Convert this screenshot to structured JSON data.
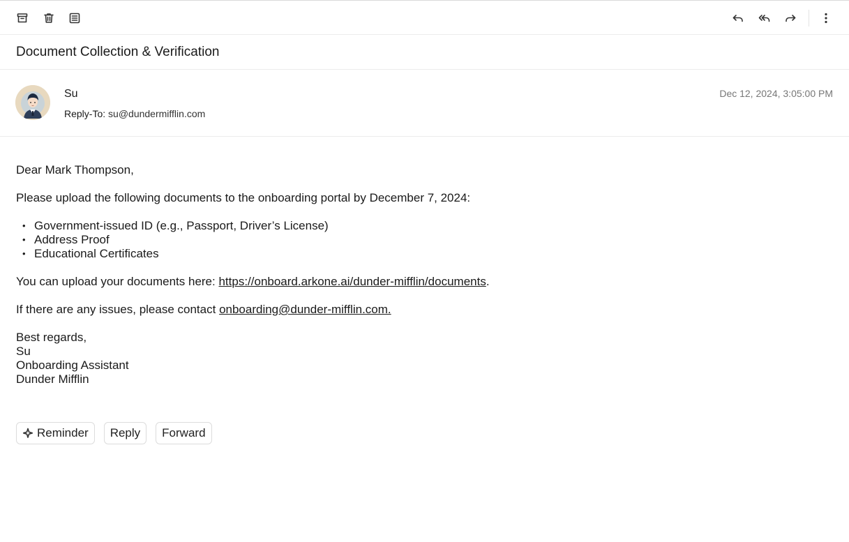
{
  "toolbar": {
    "left_icons": [
      "archive-icon",
      "trash-icon",
      "notes-icon"
    ],
    "right_icons": [
      "reply-icon",
      "reply-all-icon",
      "forward-icon",
      "more-vertical-icon"
    ]
  },
  "email": {
    "subject": "Document Collection & Verification",
    "sender_name": "Su",
    "reply_to_label": "Reply-To:",
    "reply_to_address": "su@dundermifflin.com",
    "date": "Dec 12, 2024, 3:05:00 PM",
    "greeting": "Dear Mark Thompson,",
    "intro": "Please upload the following documents to the onboarding portal by December 7, 2024:",
    "documents": [
      "Government-issued ID (e.g., Passport, Driver’s License)",
      "Address Proof",
      "Educational Certificates"
    ],
    "upload_text": "You can upload your documents here: ",
    "upload_link": "https://onboard.arkone.ai/dunder-mifflin/documents",
    "upload_suffix": ".",
    "contact_text": "If there are any issues, please contact ",
    "contact_link": "onboarding@dunder-mifflin.com.",
    "signoff": "Best regards,",
    "sig_name": "Su",
    "sig_title": "Onboarding Assistant",
    "sig_company": "Dunder Mifflin"
  },
  "actions": {
    "reminder_label": "Reminder",
    "reminder_icon": "sparkle-icon",
    "reply_label": "Reply",
    "forward_label": "Forward"
  }
}
